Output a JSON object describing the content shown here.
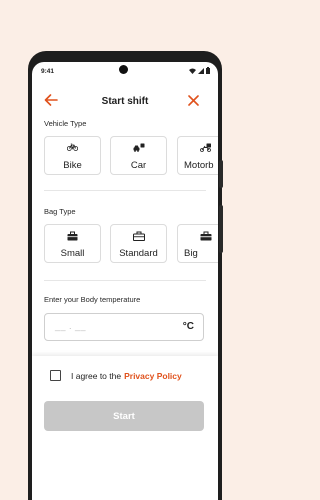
{
  "status_bar": {
    "time": "9:41"
  },
  "header": {
    "title": "Start shift"
  },
  "vehicle": {
    "label": "Vehicle Type",
    "options": [
      {
        "label": "Bike",
        "icon": "bicycle-icon"
      },
      {
        "label": "Car",
        "icon": "car-icon"
      },
      {
        "label": "Motorb",
        "icon": "motorbike-icon"
      }
    ]
  },
  "bag": {
    "label": "Bag Type",
    "options": [
      {
        "label": "Small",
        "icon": "small-bag-icon"
      },
      {
        "label": "Standard",
        "icon": "standard-bag-icon"
      },
      {
        "label": "Big",
        "icon": "big-bag-icon"
      }
    ]
  },
  "temperature": {
    "label": "Enter your Body temperature",
    "placeholder": "__ . __",
    "unit": "°C"
  },
  "consent": {
    "text": "I agree to the",
    "link": "Privacy Policy"
  },
  "start_button": {
    "label": "Start"
  },
  "colors": {
    "accent": "#e0521d",
    "background": "#fbeee6",
    "disabled_button": "#c7c7c7"
  }
}
